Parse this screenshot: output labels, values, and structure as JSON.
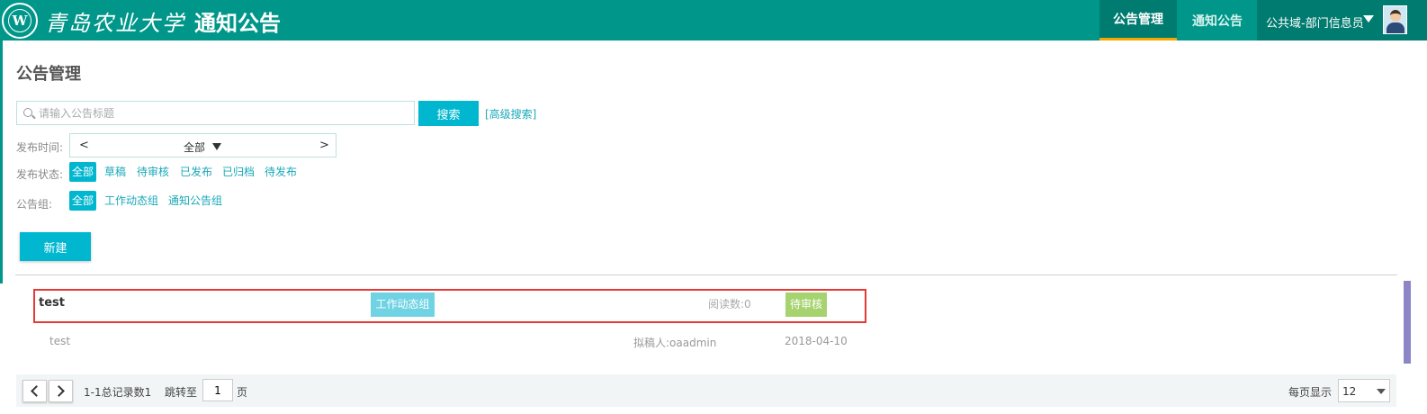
{
  "header": {
    "school_name": "青岛农业大学",
    "seal_letter": "W",
    "app_title": "通知公告",
    "nav": [
      {
        "label": "公告管理",
        "active": true
      },
      {
        "label": "通知公告",
        "active": false
      }
    ],
    "user": "公共域-部门信息员",
    "colors": {
      "header": "#00978a",
      "active_tab": "#007b70",
      "active_underline": "#f2a800"
    }
  },
  "page": {
    "title": "公告管理"
  },
  "search": {
    "placeholder": "请输入公告标题",
    "button": "搜索",
    "advanced": "[高级搜索]"
  },
  "filters": {
    "time_label": "发布时间:",
    "time_prev": "<",
    "time_next": ">",
    "time_value": "全部",
    "status_label": "发布状态:",
    "status_options": [
      "全部",
      "草稿",
      "待审核",
      "已发布",
      "已归档",
      "待发布"
    ],
    "group_label": "公告组:",
    "group_options": [
      "全部",
      "工作动态组",
      "通知公告组"
    ]
  },
  "actions": {
    "new_button": "新建"
  },
  "items": [
    {
      "title": "test",
      "group": "工作动态组",
      "read_count": "阅读数:0",
      "status": "待审核",
      "summary": "test",
      "drafter": "拟稿人:oaadmin",
      "date": "2018-04-10"
    }
  ],
  "pagination": {
    "range": "1-1总记录数1",
    "jump_label": "跳转至",
    "page_value": "1",
    "page_unit": "页",
    "per_page_label": "每页显示",
    "per_page_value": "12"
  }
}
